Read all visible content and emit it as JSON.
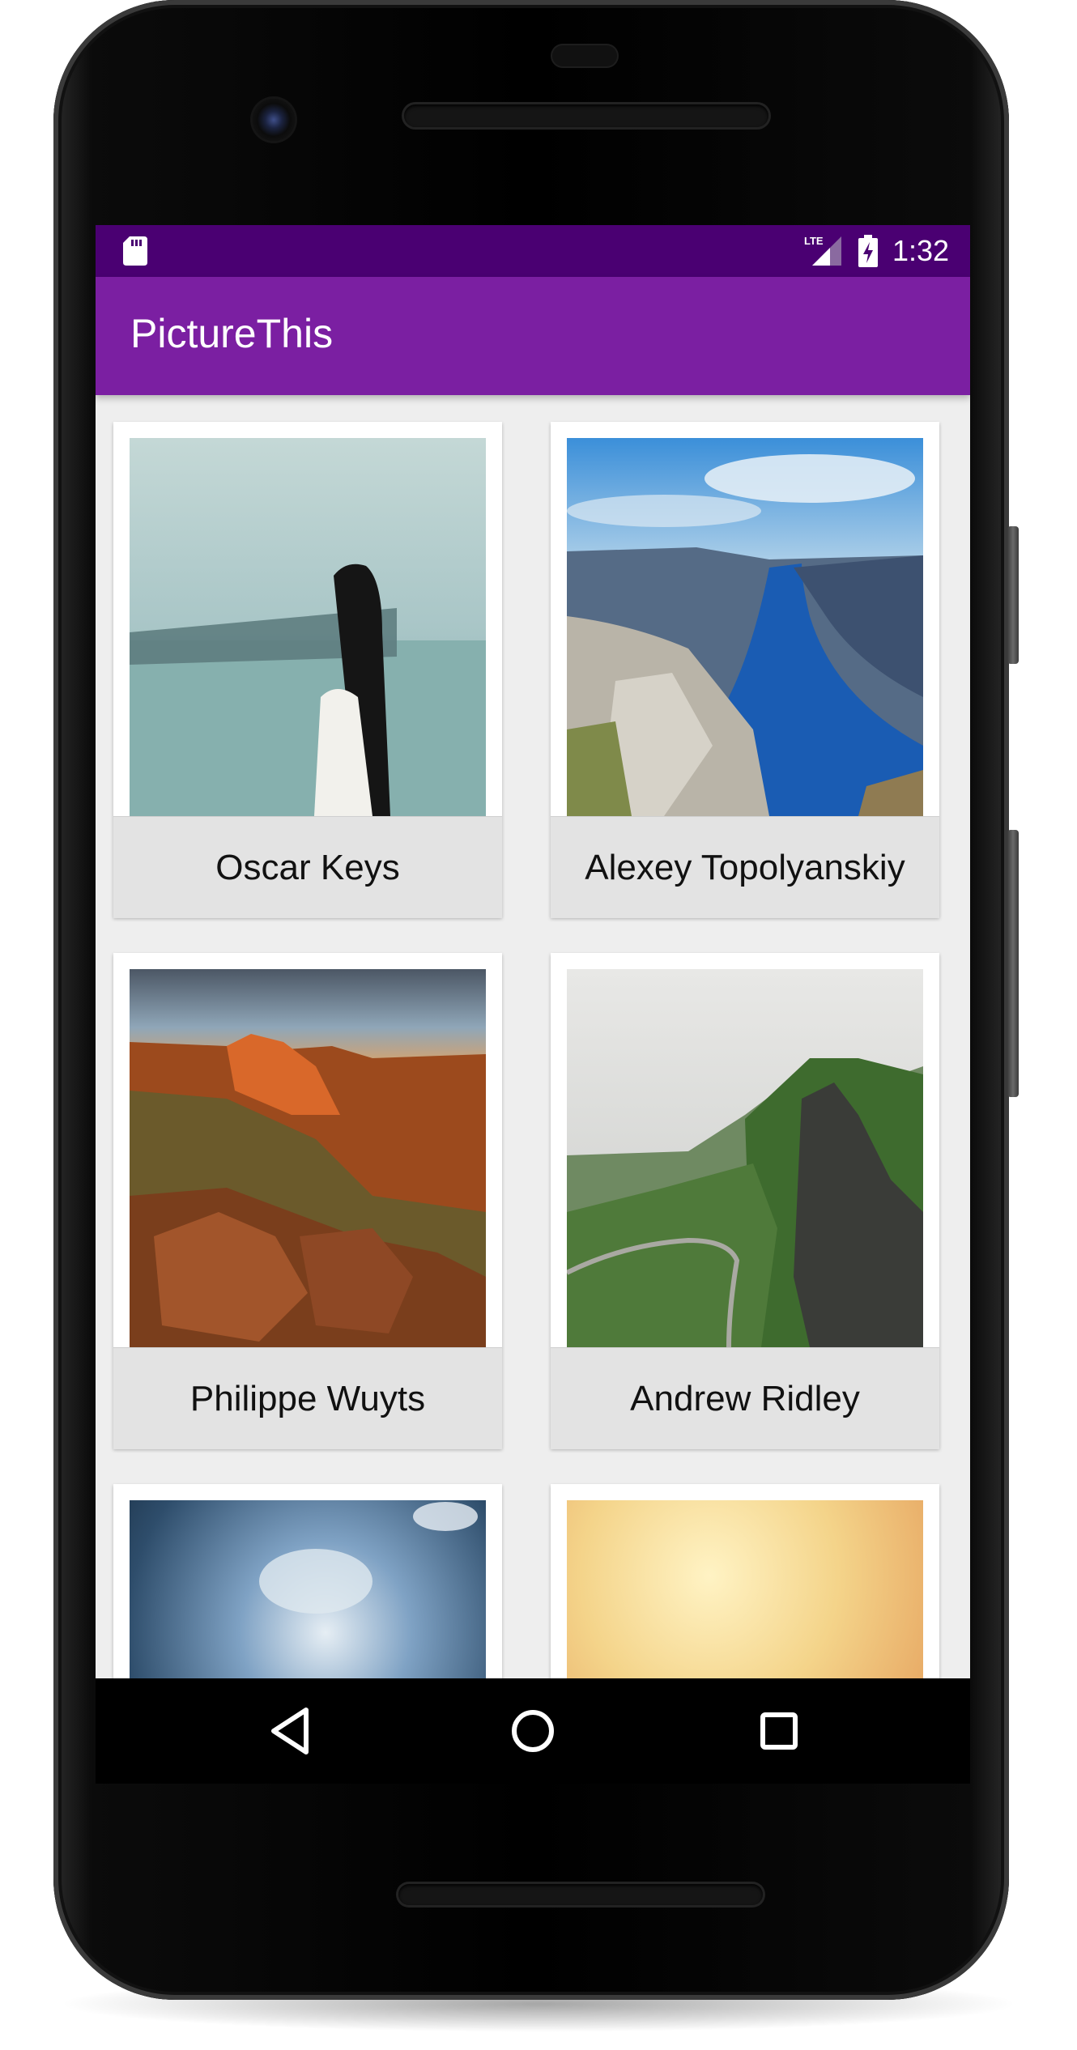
{
  "status_bar": {
    "time": "1:32",
    "network_label": "LTE",
    "icons": [
      "sd-card-icon",
      "lte-signal-icon",
      "battery-charging-icon"
    ]
  },
  "app_bar": {
    "title": "PictureThis",
    "color": "#7b1fa2",
    "status_color": "#4a0072"
  },
  "photos": [
    {
      "author": "Oscar Keys",
      "scene": "blindfolded-woman-seascape"
    },
    {
      "author": "Alexey Topolyanskiy",
      "scene": "fjord-cliffs"
    },
    {
      "author": "Philippe Wuyts",
      "scene": "red-rock-canyon-sunset"
    },
    {
      "author": "Andrew Ridley",
      "scene": "green-mountain-road"
    },
    {
      "author": "",
      "scene": "stormy-blue-sky"
    },
    {
      "author": "",
      "scene": "golden-haze"
    }
  ],
  "nav_bar": {
    "icons": [
      "back-icon",
      "home-icon",
      "recents-icon"
    ]
  }
}
